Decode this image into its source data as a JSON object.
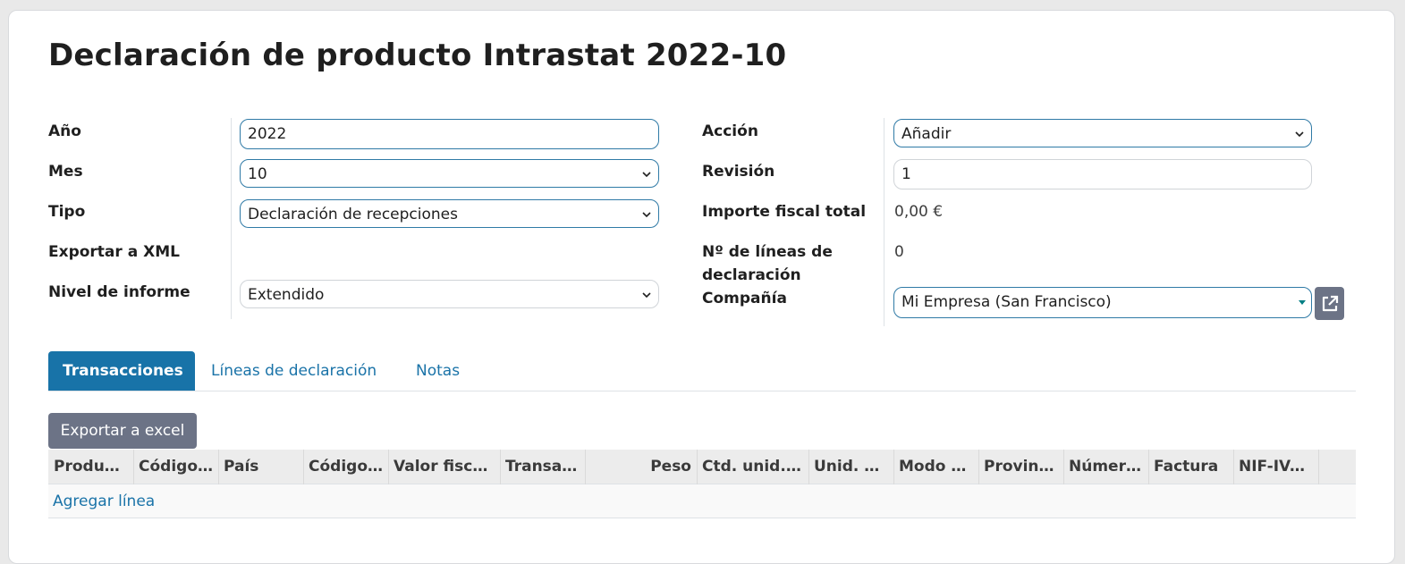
{
  "title": "Declaración de producto Intrastat 2022-10",
  "form": {
    "year": {
      "label": "Año",
      "value": "2022"
    },
    "month": {
      "label": "Mes",
      "value": "10"
    },
    "type": {
      "label": "Tipo",
      "value": "Declaración de recepciones"
    },
    "export_xml": {
      "label": "Exportar a XML"
    },
    "report_level": {
      "label": "Nivel de informe",
      "value": "Extendido"
    },
    "action": {
      "label": "Acción",
      "value": "Añadir"
    },
    "revision": {
      "label": "Revisión",
      "value": "1"
    },
    "fiscal_total": {
      "label": "Importe fiscal total",
      "value": "0,00 €"
    },
    "num_lines": {
      "label_line1": "Nº de líneas de",
      "label_line2": "declaración",
      "value": "0"
    },
    "company": {
      "label": "Compañía",
      "value": "Mi Empresa (San Francisco)"
    }
  },
  "tabs": [
    "Transacciones",
    "Líneas de declaración",
    "Notas"
  ],
  "toolbar": {
    "export_excel": "Exportar a excel"
  },
  "table": {
    "columns": [
      "Producto",
      "Código …",
      "País",
      "Código …",
      "Valor fiscal…",
      "Transa…",
      "Peso",
      "Ctd. unid. s…",
      "Unid. su…",
      "Modo d…",
      "Provinc…",
      "Númer…",
      "Factura",
      "NIF-IVA…"
    ],
    "add_line": "Agregar línea"
  },
  "colors": {
    "accent": "#1873a8",
    "focus_border": "#2f7aa6",
    "secondary_button": "#6c7386"
  },
  "icons": {
    "external_link": "external-link-icon",
    "dropdown": "chevron-down-icon"
  }
}
